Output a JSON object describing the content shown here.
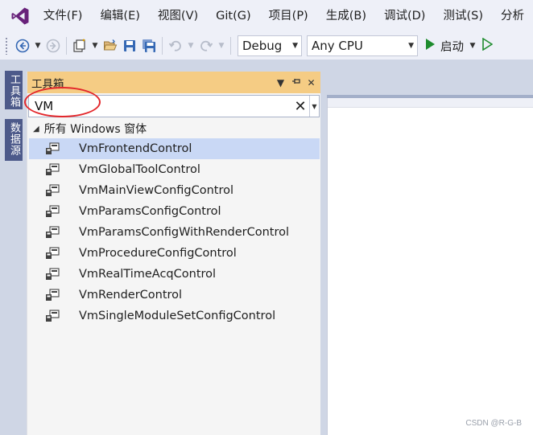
{
  "menu": {
    "items": [
      "文件(F)",
      "编辑(E)",
      "视图(V)",
      "Git(G)",
      "项目(P)",
      "生成(B)",
      "调试(D)",
      "测试(S)",
      "分析"
    ]
  },
  "toolbar": {
    "config_value": "Debug",
    "platform_value": "Any CPU",
    "start_label": "启动"
  },
  "side_tabs": {
    "toolbox": "工具箱",
    "datasource": "数据源"
  },
  "toolbox": {
    "title": "工具箱",
    "search_value": "VM",
    "clear_glyph": "✕",
    "group_name": "所有 Windows 窗体",
    "items": [
      {
        "label": "VmFrontendControl",
        "selected": true
      },
      {
        "label": "VmGlobalToolControl",
        "selected": false
      },
      {
        "label": "VmMainViewConfigControl",
        "selected": false
      },
      {
        "label": "VmParamsConfigControl",
        "selected": false
      },
      {
        "label": "VmParamsConfigWithRenderControl",
        "selected": false
      },
      {
        "label": "VmProcedureConfigControl",
        "selected": false
      },
      {
        "label": "VmRealTimeAcqControl",
        "selected": false
      },
      {
        "label": "VmRenderControl",
        "selected": false
      },
      {
        "label": "VmSingleModuleSetConfigControl",
        "selected": false
      }
    ]
  },
  "watermark": "CSDN @R-G-B",
  "colors": {
    "accent_purple": "#68217a",
    "toolbox_title_bg": "#f5cc84",
    "selection_bg": "#c9d8f5",
    "side_tab_bg": "#4d5a8a",
    "annotation_red": "#e3262a",
    "play_green": "#1e8c2e"
  },
  "icons": {
    "vs_logo": "visual-studio-logo-icon",
    "tool_item": "user-control-icon"
  }
}
